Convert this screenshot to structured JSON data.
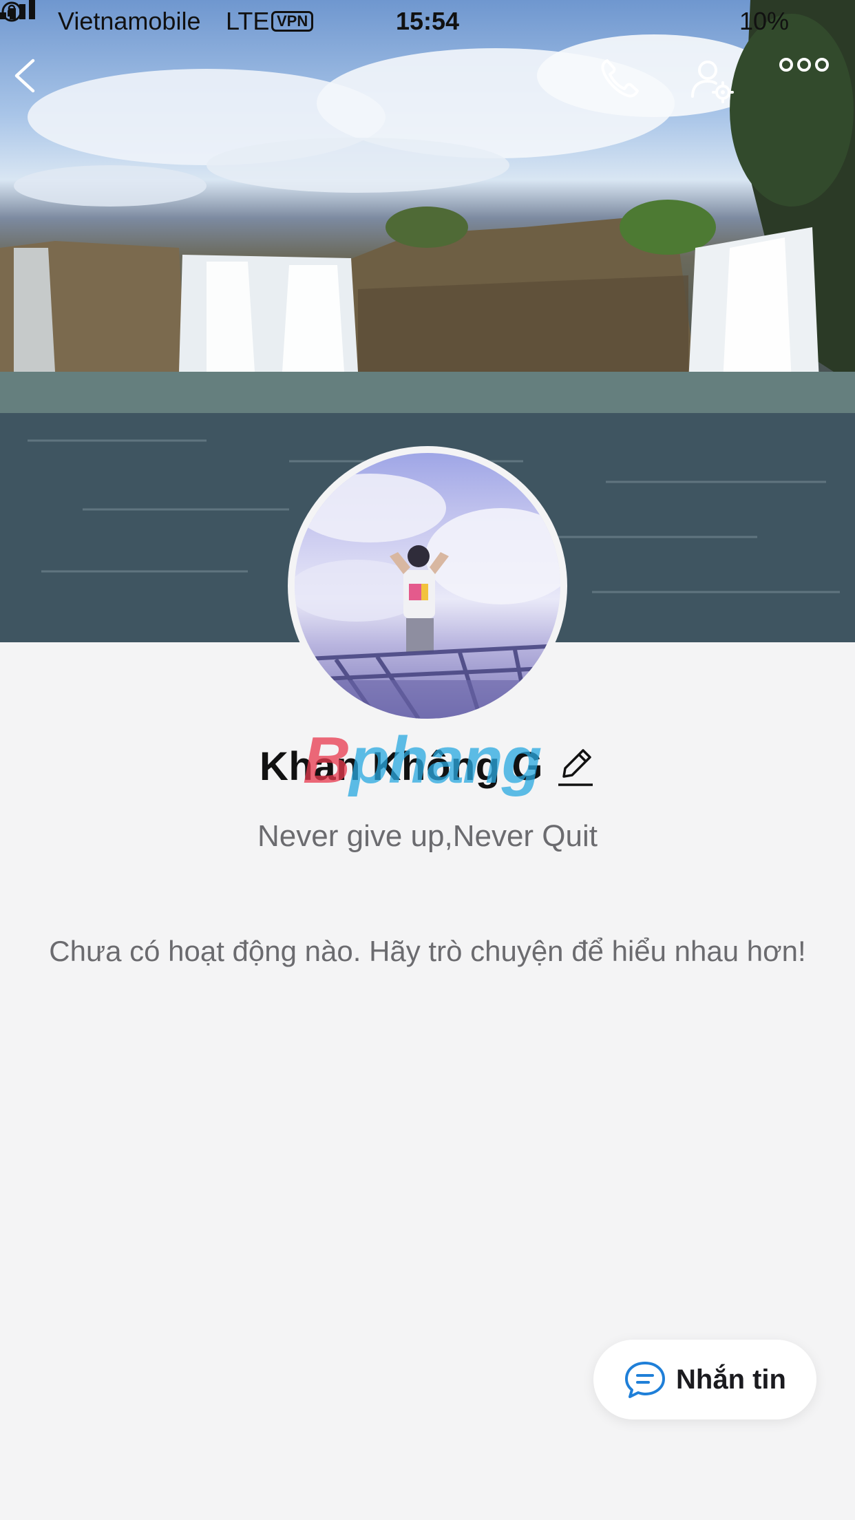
{
  "status_bar": {
    "carrier": "Vietnamobile",
    "network": "LTE",
    "vpn": "VPN",
    "time": "15:54",
    "battery": "10%"
  },
  "nav": {
    "back_icon": "chevron-left-icon",
    "call_icon": "phone-icon",
    "settings_icon": "user-settings-icon",
    "more_icon": "more-icon"
  },
  "profile": {
    "name": "Khan Không G",
    "status_message": "Never give up,Never Quit",
    "empty_activity": "Chưa có hoạt động nào. Hãy trò chuyện để hiểu nhau hơn!"
  },
  "watermark": {
    "first": "B",
    "rest": "phang"
  },
  "actions": {
    "message_label": "Nhắn tin"
  },
  "colors": {
    "background": "#f4f4f5",
    "accent": "#1f7fd8",
    "text_muted": "#6b6b6f"
  }
}
